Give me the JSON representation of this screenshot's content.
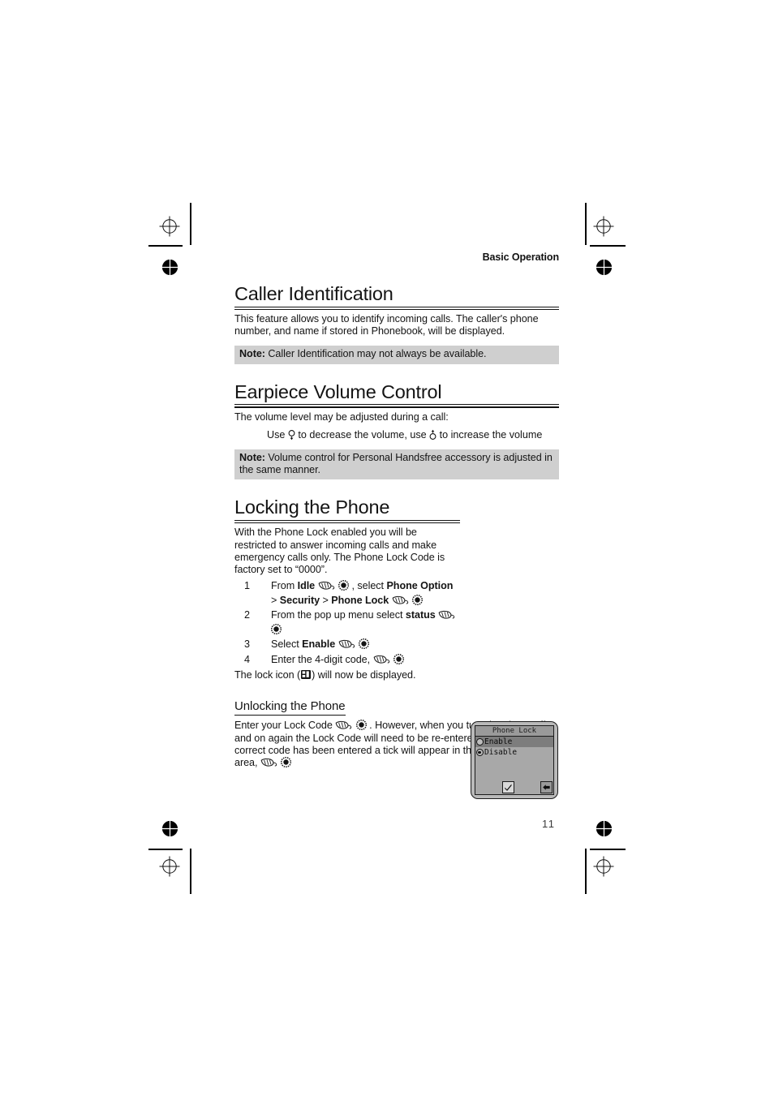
{
  "header": {
    "running_head": "Basic Operation"
  },
  "sections": {
    "caller_id": {
      "title": "Caller Identification",
      "body": "This feature allows you to identify incoming calls. The caller's phone number, and name if stored in Phonebook, will be displayed.",
      "note_label": "Note:",
      "note_text": "Caller Identification may not always be available."
    },
    "earpiece": {
      "title": "Earpiece Volume Control",
      "body": "The volume level may be adjusted during a call:",
      "instruction_pre": "Use",
      "instruction_mid": "to decrease the volume, use",
      "instruction_post": "to increase the volume",
      "note_label": "Note:",
      "note_text": "Volume control for Personal Handsfree accessory is adjusted in the same manner."
    },
    "locking": {
      "title": "Locking the Phone",
      "body": "With the Phone Lock enabled you will be restricted to answer incoming calls and make emergency calls only. The Phone Lock Code is factory set to “0000”.",
      "steps": [
        {
          "num": "1",
          "parts": [
            {
              "t": "text",
              "v": "From "
            },
            {
              "t": "bold",
              "v": "Idle"
            },
            {
              "t": "icon",
              "v": "scroll-key-icon"
            },
            {
              "t": "icon",
              "v": "select-key-icon"
            },
            {
              "t": "text",
              "v": ", select "
            },
            {
              "t": "bold",
              "v": "Phone Option"
            },
            {
              "t": "text",
              "v": " > "
            },
            {
              "t": "bold",
              "v": "Security"
            },
            {
              "t": "text",
              "v": " > "
            },
            {
              "t": "bold",
              "v": "Phone Lock"
            },
            {
              "t": "icon",
              "v": "scroll-key-icon"
            },
            {
              "t": "icon",
              "v": "select-key-icon"
            }
          ]
        },
        {
          "num": "2",
          "parts": [
            {
              "t": "text",
              "v": "From the pop up menu select "
            },
            {
              "t": "bold",
              "v": "status"
            },
            {
              "t": "icon",
              "v": "scroll-key-icon"
            },
            {
              "t": "icon",
              "v": "select-key-icon"
            }
          ]
        },
        {
          "num": "3",
          "parts": [
            {
              "t": "text",
              "v": "Select "
            },
            {
              "t": "bold",
              "v": "Enable"
            },
            {
              "t": "icon",
              "v": "scroll-key-icon"
            },
            {
              "t": "icon",
              "v": "select-key-icon"
            }
          ]
        },
        {
          "num": "4",
          "parts": [
            {
              "t": "text",
              "v": "Enter the 4-digit code, "
            },
            {
              "t": "icon",
              "v": "scroll-key-icon"
            },
            {
              "t": "icon",
              "v": "select-key-icon"
            }
          ]
        }
      ],
      "closing_pre": "The lock icon (",
      "closing_post": ") will now be displayed."
    },
    "unlocking": {
      "title": "Unlocking the Phone",
      "parts": [
        {
          "t": "text",
          "v": "Enter your Lock Code "
        },
        {
          "t": "icon",
          "v": "scroll-key-icon"
        },
        {
          "t": "icon",
          "v": "select-key-icon"
        },
        {
          "t": "text",
          "v": ". However, when you turn the phone off and on again the Lock Code will need to be re-entered. When the correct code has been entered a tick will appear in the primary selection area, "
        },
        {
          "t": "icon",
          "v": "scroll-key-icon"
        },
        {
          "t": "icon",
          "v": "select-key-icon"
        }
      ]
    }
  },
  "phone_screen": {
    "title": "Phone Lock",
    "options": [
      {
        "label": "Enable",
        "selected": true,
        "radio_on": false
      },
      {
        "label": "Disable",
        "selected": false,
        "radio_on": true
      }
    ],
    "softkey_left": "tick-icon",
    "softkey_right": "back-arrow-icon"
  },
  "footer": {
    "page_number": "11"
  },
  "colors": {
    "note_background": "#cfcfcf",
    "screen_body": "#a8a8a8",
    "screen_titlebar": "#9a9a9a",
    "screen_highlight": "#7d7d7d",
    "ink": "#141414"
  }
}
